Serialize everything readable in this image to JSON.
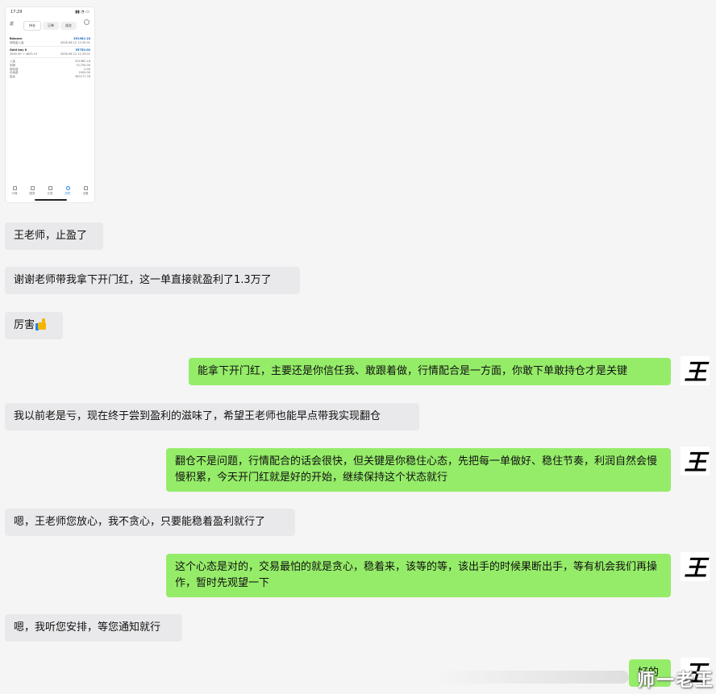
{
  "phone": {
    "time": "17:29",
    "back": "返",
    "tabs": [
      {
        "label": "持仓"
      },
      {
        "label": "订单"
      },
      {
        "label": "成交"
      }
    ],
    "rows": [
      {
        "left": "Balance",
        "right": "551982.18"
      },
      {
        "left": "体验金入金",
        "right": "2026-06-12 11:30:01"
      },
      {
        "left": "Gold buy 0",
        "right": "55750.00"
      },
      {
        "left": "2640.00 → 4623.10",
        "right": "2026-06-12 11:33:01"
      },
      {
        "left": "入金",
        "right": "331982.18"
      },
      {
        "left": "利润",
        "right": "13,750.00"
      },
      {
        "left": "库存费",
        "right": "0.00"
      },
      {
        "left": "手续费",
        "right": "2000.00"
      },
      {
        "left": "结余",
        "right": "367277.78"
      }
    ],
    "nav": [
      {
        "label": "行情"
      },
      {
        "label": "图表"
      },
      {
        "label": "交易"
      },
      {
        "label": "历史"
      },
      {
        "label": "设置"
      }
    ]
  },
  "messages": [
    {
      "side": "left",
      "text": "王老师，止盈了"
    },
    {
      "side": "left",
      "text": "谢谢老师带我拿下开门红，这一单直接就盈利了1.3万了"
    },
    {
      "side": "left",
      "text": "厉害"
    },
    {
      "side": "right",
      "text": "能拿下开门红，主要还是你信任我、敢跟着做，行情配合是一方面，你敢下单敢持仓才是关键"
    },
    {
      "side": "left",
      "text": "我以前老是亏，现在终于尝到盈利的滋味了，希望王老师也能早点带我实现翻仓"
    },
    {
      "side": "right",
      "text": "翻仓不是问题，行情配合的话会很快，但关键是你稳住心态，先把每一单做好、稳住节奏，利润自然会慢慢积累，今天开门红就是好的开始，继续保持这个状态就行"
    },
    {
      "side": "left",
      "text": "嗯，王老师您放心，我不贪心，只要能稳着盈利就行了"
    },
    {
      "side": "right",
      "text": "这个心态是对的，交易最怕的就是贪心，稳着来，该等的等，该出手的时候果断出手，等有机会我们再操作，暂时先观望一下"
    },
    {
      "side": "left",
      "text": "嗯，我听您安排，等您通知就行"
    },
    {
      "side": "right",
      "text": "好的"
    }
  ],
  "avatar": {
    "glyph": "王"
  },
  "watermark": "师一老王"
}
